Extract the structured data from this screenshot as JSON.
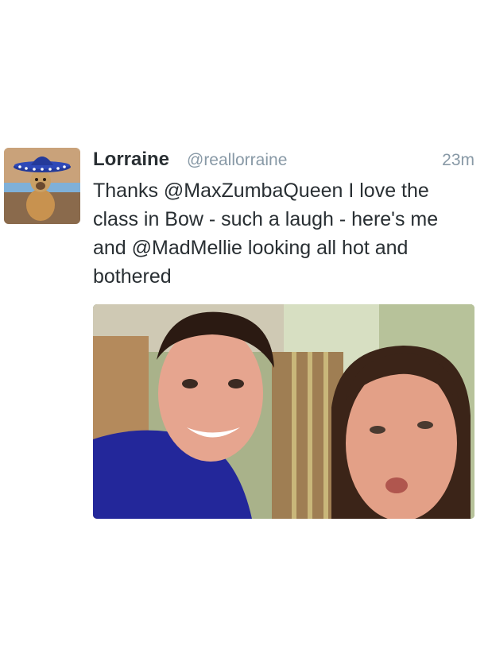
{
  "tweet": {
    "display_name": "Lorraine",
    "handle": "@reallorraine",
    "time": "23m",
    "text": "Thanks @MaxZumbaQueen I love the class in Bow - such a laugh - here's me and @MadMellie looking all hot and bothered",
    "avatar_icon": "dog-in-sombrero-avatar",
    "photo_icon": "selfie-photo"
  }
}
